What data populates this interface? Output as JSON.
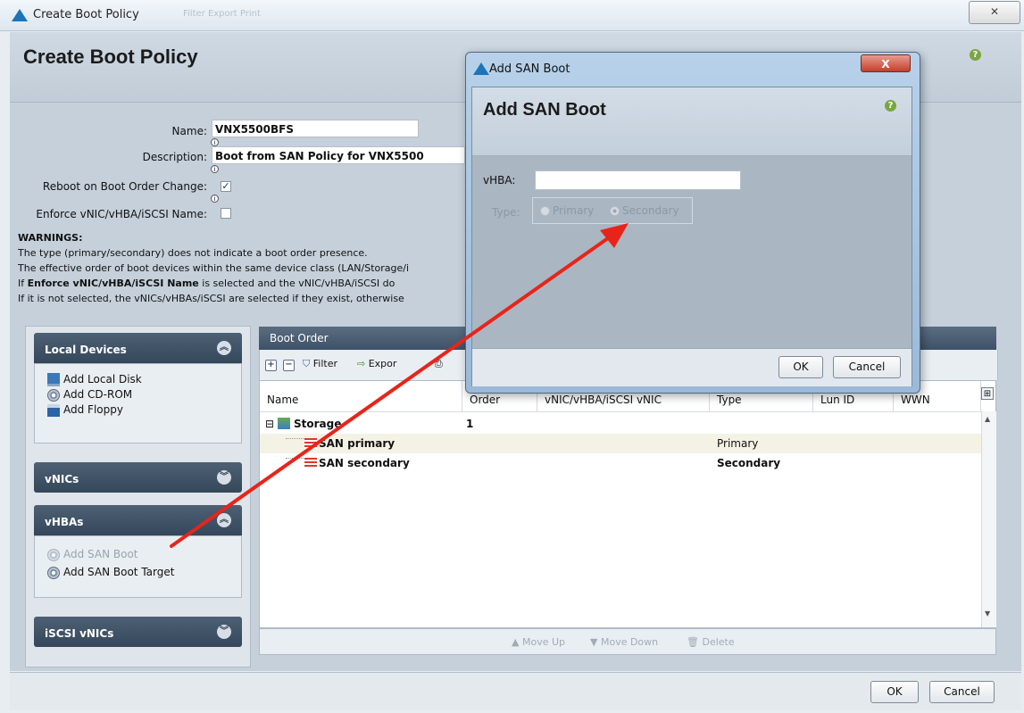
{
  "window": {
    "title": "Create Boot Policy",
    "faded_toolbar": "Filter  Export  Print",
    "close_label": "✕"
  },
  "header": {
    "title": "Create Boot Policy",
    "help": "?"
  },
  "form": {
    "name_label": "Name:",
    "name_value": "VNX5500BFS",
    "description_label": "Description:",
    "description_value": "Boot from SAN Policy for VNX5500",
    "reboot_label": "Reboot on Boot Order Change:",
    "reboot_checked": "✓",
    "enforce_label": "Enforce vNIC/vHBA/iSCSI Name:"
  },
  "warnings": {
    "title": "WARNINGS:",
    "line1": "The type (primary/secondary) does not indicate a boot order presence.",
    "line2": "The effective order of boot devices within the same device class (LAN/Storage/i",
    "line3_prefix": "If ",
    "line3_bold": "Enforce vNIC/vHBA/iSCSI Name",
    "line3_suffix": " is selected and the vNIC/vHBA/iSCSI do",
    "line4": "If it is not selected, the vNICs/vHBAs/iSCSI are selected if they exist, otherwise"
  },
  "left_panel": {
    "local_devices": {
      "title": "Local Devices",
      "items": [
        "Add Local Disk",
        "Add CD-ROM",
        "Add Floppy"
      ]
    },
    "vnics": {
      "title": "vNICs"
    },
    "vhbas": {
      "title": "vHBAs",
      "items": [
        "Add SAN Boot",
        "Add SAN Boot Target"
      ]
    },
    "iscsi": {
      "title": "iSCSI vNICs"
    }
  },
  "boot_order": {
    "title": "Boot Order",
    "toolbar": {
      "filter": "Filter",
      "export": "Expor"
    },
    "columns": [
      "Name",
      "Order",
      "vNIC/vHBA/iSCSI vNIC",
      "Type",
      "Lun ID",
      "WWN"
    ],
    "rows": [
      {
        "name": "Storage",
        "order": "1",
        "type": ""
      },
      {
        "name": "SAN primary",
        "order": "",
        "type": "Primary"
      },
      {
        "name": "SAN secondary",
        "order": "",
        "type": "Secondary"
      }
    ],
    "footer": {
      "move_up": "Move Up",
      "move_down": "Move Down",
      "delete": "Delete"
    }
  },
  "bottom": {
    "ok": "OK",
    "cancel": "Cancel"
  },
  "modal": {
    "window_title": "Add SAN Boot",
    "title": "Add SAN Boot",
    "close": "X",
    "vhba_label": "vHBA:",
    "vhba_value": "",
    "type_label": "Type:",
    "type_options": [
      "Primary",
      "Secondary"
    ],
    "ok": "OK",
    "cancel": "Cancel"
  },
  "colors": {
    "arrow": "#e8241a",
    "accent": "#1c74b9",
    "help": "#7aa63e"
  }
}
